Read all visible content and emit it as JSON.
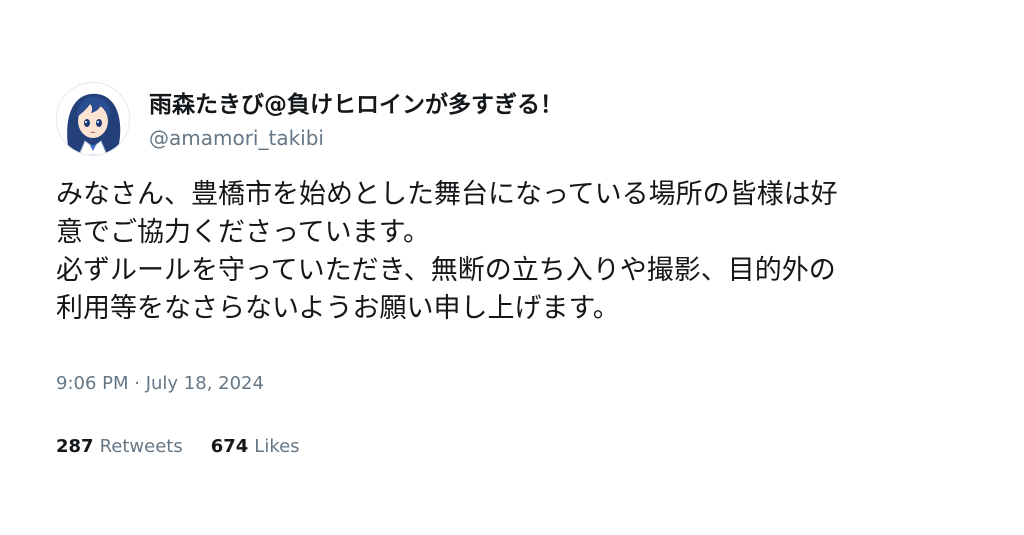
{
  "author": {
    "display_name": "雨森たきび@負けヒロインが多すぎる！",
    "handle": "@amamori_takibi",
    "avatar_icon": "anime-girl-avatar-icon"
  },
  "tweet": {
    "lines": [
      "みなさん、豊橋市を始めとした舞台になっている場所の皆様は好",
      "意でご協力くださっています。",
      "必ずルールを守っていただき、無断の立ち入りや撮影、目的外の",
      "利用等をなさらないようお願い申し上げます。"
    ],
    "timestamp": "9:06 PM · July 18, 2024"
  },
  "stats": {
    "retweets_count": "287",
    "retweets_label": "Retweets",
    "likes_count": "674",
    "likes_label": "Likes"
  },
  "colors": {
    "text": "#14171a",
    "secondary": "#657786",
    "avatar_hair": "#24407a"
  }
}
